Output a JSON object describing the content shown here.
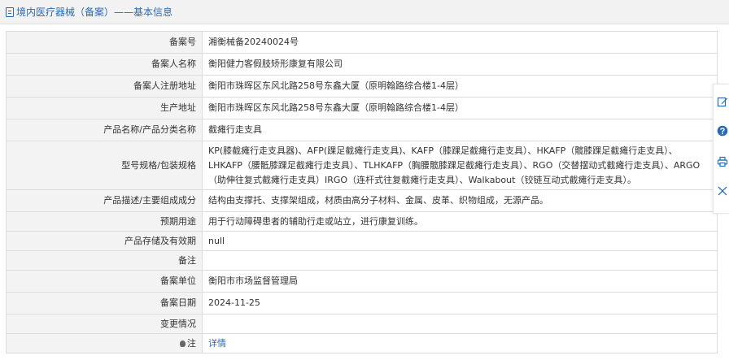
{
  "header": {
    "breadcrumb": "境内医疗器械（备案）",
    "separator": "——",
    "section": "基本信息"
  },
  "rows": [
    {
      "label": "备案号",
      "value": "湘衡械备20240024号"
    },
    {
      "label": "备案人名称",
      "value": "衡阳健力客假肢矫形康复有限公司"
    },
    {
      "label": "备案人注册地址",
      "value": "衡阳市珠晖区东风北路258号东鑫大厦（原明翰路综合楼1-4层）"
    },
    {
      "label": "生产地址",
      "value": "衡阳市珠晖区东风北路258号东鑫大厦（原明翰路综合楼1-4层）"
    },
    {
      "label": "产品名称/产品分类名称",
      "value": "截瘫行走支具"
    },
    {
      "label": "型号规格/包装规格",
      "value": "KP(膝截瘫行走支具器)、AFP(踝足截瘫行走支具)、KAFP（膝踝足截瘫行走支具）、HKAFP（髋膝踝足截瘫行走支具）、LHKAFP（腰骶膝踝足截瘫行走支具）、TLHKAFP（胸腰髋膝踝足截瘫行走支具）、RGO（交替摆动式截瘫行走支具）、ARGO（助伸往复式截瘫行走支具）IRGO（连杆式往复截瘫行走支具）、Walkabout（铰链互动式截瘫行走支具）。"
    },
    {
      "label": "产品描述/主要组成成分",
      "value": "结构由支撑托、支撑架组成，材质由高分子材料、金属、皮革、织物组成，无源产品。"
    },
    {
      "label": "预期用途",
      "value": "用于行动障碍患者的辅助行走或站立，进行康复训练。"
    },
    {
      "label": "产品存储及有效期",
      "value": "null"
    },
    {
      "label": "备注",
      "value": ""
    },
    {
      "label": "备案单位",
      "value": "衡阳市市场监督管理局"
    },
    {
      "label": "备案日期",
      "value": "2024-11-25"
    },
    {
      "label": "变更情况",
      "value": ""
    },
    {
      "label": "注",
      "value": "详情"
    }
  ],
  "toolbar": [
    "edit-icon",
    "help-icon",
    "print-icon",
    "close-icon"
  ],
  "colors": {
    "accent": "#2a6ab0",
    "label_bg": "#f3f3f3",
    "border": "#dcdcdc"
  }
}
